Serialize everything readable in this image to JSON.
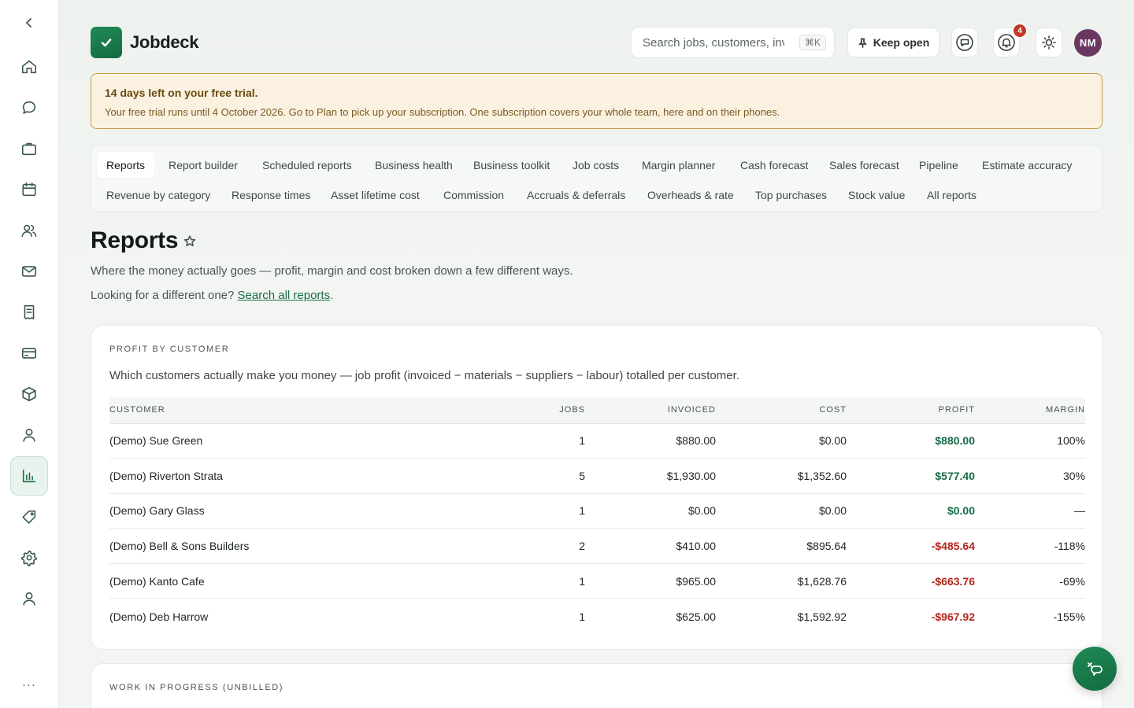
{
  "app": {
    "name": "Jobdeck"
  },
  "rail": {
    "items": [
      {
        "icon": "home-icon"
      },
      {
        "icon": "chat-icon"
      },
      {
        "icon": "briefcase-icon"
      },
      {
        "icon": "calendar-icon"
      },
      {
        "icon": "users-icon"
      },
      {
        "icon": "mail-icon"
      },
      {
        "icon": "receipt-icon"
      },
      {
        "icon": "credit-card-icon"
      },
      {
        "icon": "box-icon"
      },
      {
        "icon": "person-icon"
      },
      {
        "icon": "bar-chart-icon",
        "active": true
      },
      {
        "icon": "tag-icon"
      },
      {
        "icon": "gear-icon"
      },
      {
        "icon": "account-icon"
      }
    ],
    "more": "···"
  },
  "header": {
    "search_placeholder": "Search jobs, customers, invoices",
    "search_shortcut": "⌘K",
    "keep_open_label": "Keep open",
    "notification_count": "4",
    "avatar_initials": "NM"
  },
  "trial": {
    "title": "14 days left on your free trial.",
    "body": "Your free trial runs until 4 October 2026. Go to Plan to pick up your subscription. One subscription covers your whole team, here and on their phones."
  },
  "tabs": {
    "row1": [
      "Reports",
      "Report builder",
      "Scheduled reports",
      "Business health",
      "Business toolkit",
      "Job costs",
      "Margin planner",
      "Cash forecast",
      "Sales forecast",
      "Pipeline",
      "Estimate accuracy"
    ],
    "row2": [
      "Revenue by category",
      "Response times",
      "Asset lifetime cost",
      "Commission",
      "Accruals & deferrals",
      "Overheads & rate",
      "Top purchases",
      "Stock value",
      "All reports"
    ]
  },
  "page": {
    "title": "Reports",
    "subtitle": "Where the money actually goes — profit, margin and cost broken down a few different ways.",
    "looking_prefix": "Looking for a different one?",
    "looking_link": "Search all reports",
    "looking_suffix": "."
  },
  "profit_card": {
    "label": "PROFIT BY CUSTOMER",
    "description": "Which customers actually make you money — job profit (invoiced − materials − suppliers − labour) totalled per customer.",
    "columns": {
      "customer": "CUSTOMER",
      "jobs": "JOBS",
      "invoiced": "INVOICED",
      "cost": "COST",
      "profit": "PROFIT",
      "margin": "MARGIN"
    },
    "rows": [
      {
        "customer": "(Demo) Sue Green",
        "jobs": "1",
        "invoiced": "$880.00",
        "cost": "$0.00",
        "profit": "$880.00",
        "margin": "100%",
        "sign": "pos"
      },
      {
        "customer": "(Demo) Riverton Strata",
        "jobs": "5",
        "invoiced": "$1,930.00",
        "cost": "$1,352.60",
        "profit": "$577.40",
        "margin": "30%",
        "sign": "pos"
      },
      {
        "customer": "(Demo) Gary Glass",
        "jobs": "1",
        "invoiced": "$0.00",
        "cost": "$0.00",
        "profit": "$0.00",
        "margin": "—",
        "sign": "pos"
      },
      {
        "customer": "(Demo) Bell & Sons Builders",
        "jobs": "2",
        "invoiced": "$410.00",
        "cost": "$895.64",
        "profit": "-$485.64",
        "margin": "-118%",
        "sign": "neg"
      },
      {
        "customer": "(Demo) Kanto Cafe",
        "jobs": "1",
        "invoiced": "$965.00",
        "cost": "$1,628.76",
        "profit": "-$663.76",
        "margin": "-69%",
        "sign": "neg"
      },
      {
        "customer": "(Demo) Deb Harrow",
        "jobs": "1",
        "invoiced": "$625.00",
        "cost": "$1,592.92",
        "profit": "-$967.92",
        "margin": "-155%",
        "sign": "neg"
      }
    ]
  },
  "wip_card": {
    "label": "WORK IN PROGRESS (UNBILLED)"
  },
  "colors": {
    "brand": "#176b46",
    "negative": "#b3261e",
    "trial_border": "#c99a3c"
  }
}
